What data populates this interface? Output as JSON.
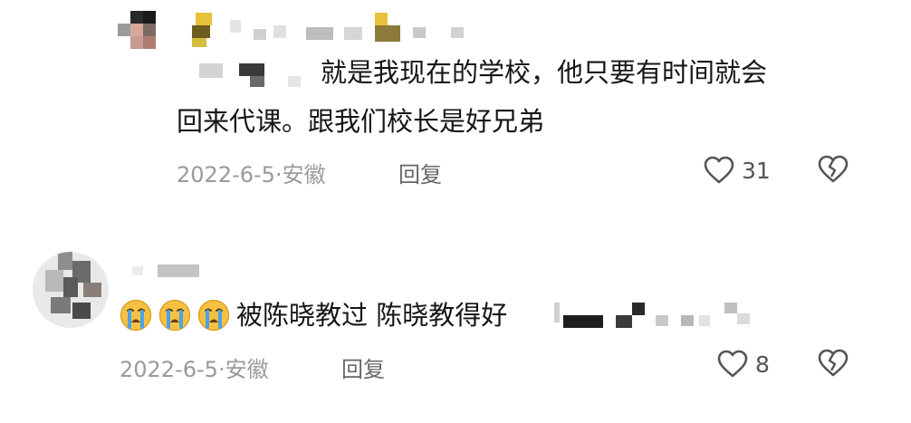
{
  "comments": [
    {
      "text_line1": "就是我现在的学校，他只要有时间就会",
      "text_line2": "回来代课。跟我们校长是好兄弟",
      "date": "2022-6-5",
      "location": "安徽",
      "reply_label": "回复",
      "like_count": "31",
      "icons": [
        "heart-outline-icon",
        "broken-heart-icon"
      ]
    },
    {
      "text": "被陈晓教过 陈晓教得好",
      "emoji_count": 3,
      "emoji_name": "crying-face-emoji",
      "date": "2022-6-5",
      "location": "安徽",
      "reply_label": "回复",
      "like_count": "8",
      "icons": [
        "heart-outline-icon",
        "broken-heart-icon"
      ]
    }
  ],
  "separator": "·",
  "colors": {
    "meta": "#9a9a9a",
    "emoji_yellow": "#f6c142",
    "emoji_tear": "#4aa3e8"
  }
}
